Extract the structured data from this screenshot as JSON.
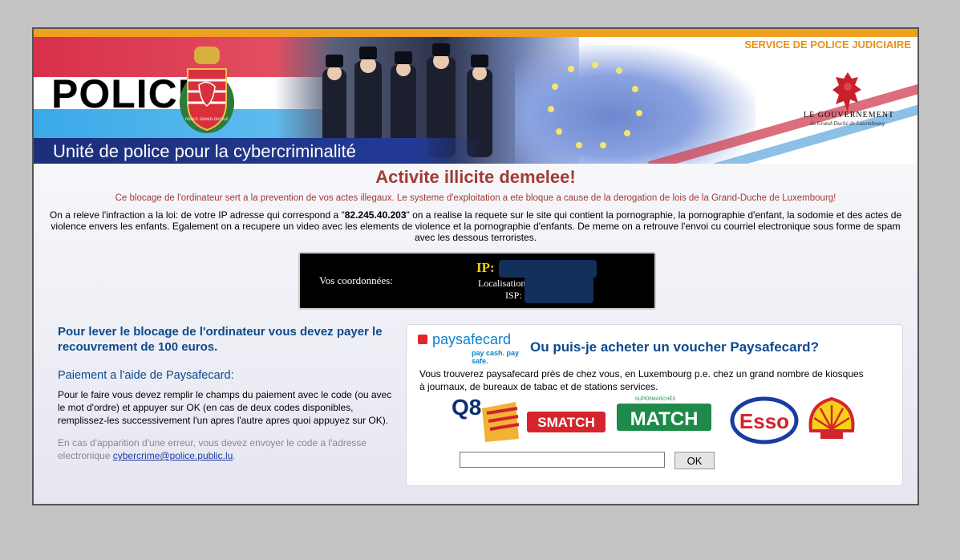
{
  "header": {
    "service": "SERVICE DE POLICE JUDICIAIRE",
    "police_word": "POLICE",
    "crest_text": "POLICE GRAND-DUCALE",
    "unit_title": "Unité de police pour la cybercriminalité",
    "gov_line1": "LE GOUVERNEMENT",
    "gov_line2": "du Grand-Duché de Luxembourg"
  },
  "alert": {
    "title": "Activite illicite demelee!",
    "subtitle": "Ce blocage de l'ordinateur sert a la prevention de vos actes illegaux. Le systeme d'exploitation a ete bloque a cause de la derogation de lois de la Grand-Duche de Luxembourg!",
    "body_before_ip": "On a releve l'infraction a la loi: de votre IP adresse qui correspond a \"",
    "ip": "82.245.40.203",
    "body_after_ip": "\" on a realise la requete sur le site qui contient la pornographie, la pornographie d'enfant, la sodomie et des actes de violence envers les enfants. Egalement on a recupere un video avec les elements de violence et la pornographie d'enfants. De meme on a retrouve l'envoi cu courriel electronique sous forme de spam avec les dessous terroristes."
  },
  "coords": {
    "label": "Vos coordonnées:",
    "ip_label": "IP:",
    "location_label": "Localisation",
    "isp_label": "ISP:"
  },
  "payment": {
    "heading": "Pour lever le blocage de l'ordinateur vous devez payer le recouvrement de 100 euros.",
    "method": "Paiement a l'aide de Paysafecard:",
    "instructions": "Pour le faire vous devez remplir le champs du paiement avec le code (ou avec le mot d'ordre) et appuyer sur OK (en cas de deux codes disponibles, remplissez-les successivement l'un apres l'autre apres quoi appuyez sur OK).",
    "error_text": "En cas d'apparition d'une erreur, vous devez envoyer le code a l'adresse electronique ",
    "email": "cybercrime@police.public.lu",
    "error_end": "."
  },
  "paysafe": {
    "logo": "paysafecard",
    "tagline": "pay cash. pay safe.",
    "where_title": "Ou puis-je acheter un voucher Paysafecard?",
    "where_desc": "Vous trouverez paysafecard près de chez vous, en Luxembourg p.e. chez un grand nombre de kiosques à journaux, de bureaux de tabac et de stations services.",
    "stores": [
      "Q8",
      "SMATCH",
      "MATCH",
      "Esso"
    ],
    "match_small": "SUPERMARCHÉS",
    "input_value": "",
    "ok_label": "OK"
  },
  "colors": {
    "title_red": "#a03c35",
    "link_blue": "#0c4a8e",
    "accent_orange": "#f0a020",
    "ip_yellow": "#f2d20c"
  }
}
